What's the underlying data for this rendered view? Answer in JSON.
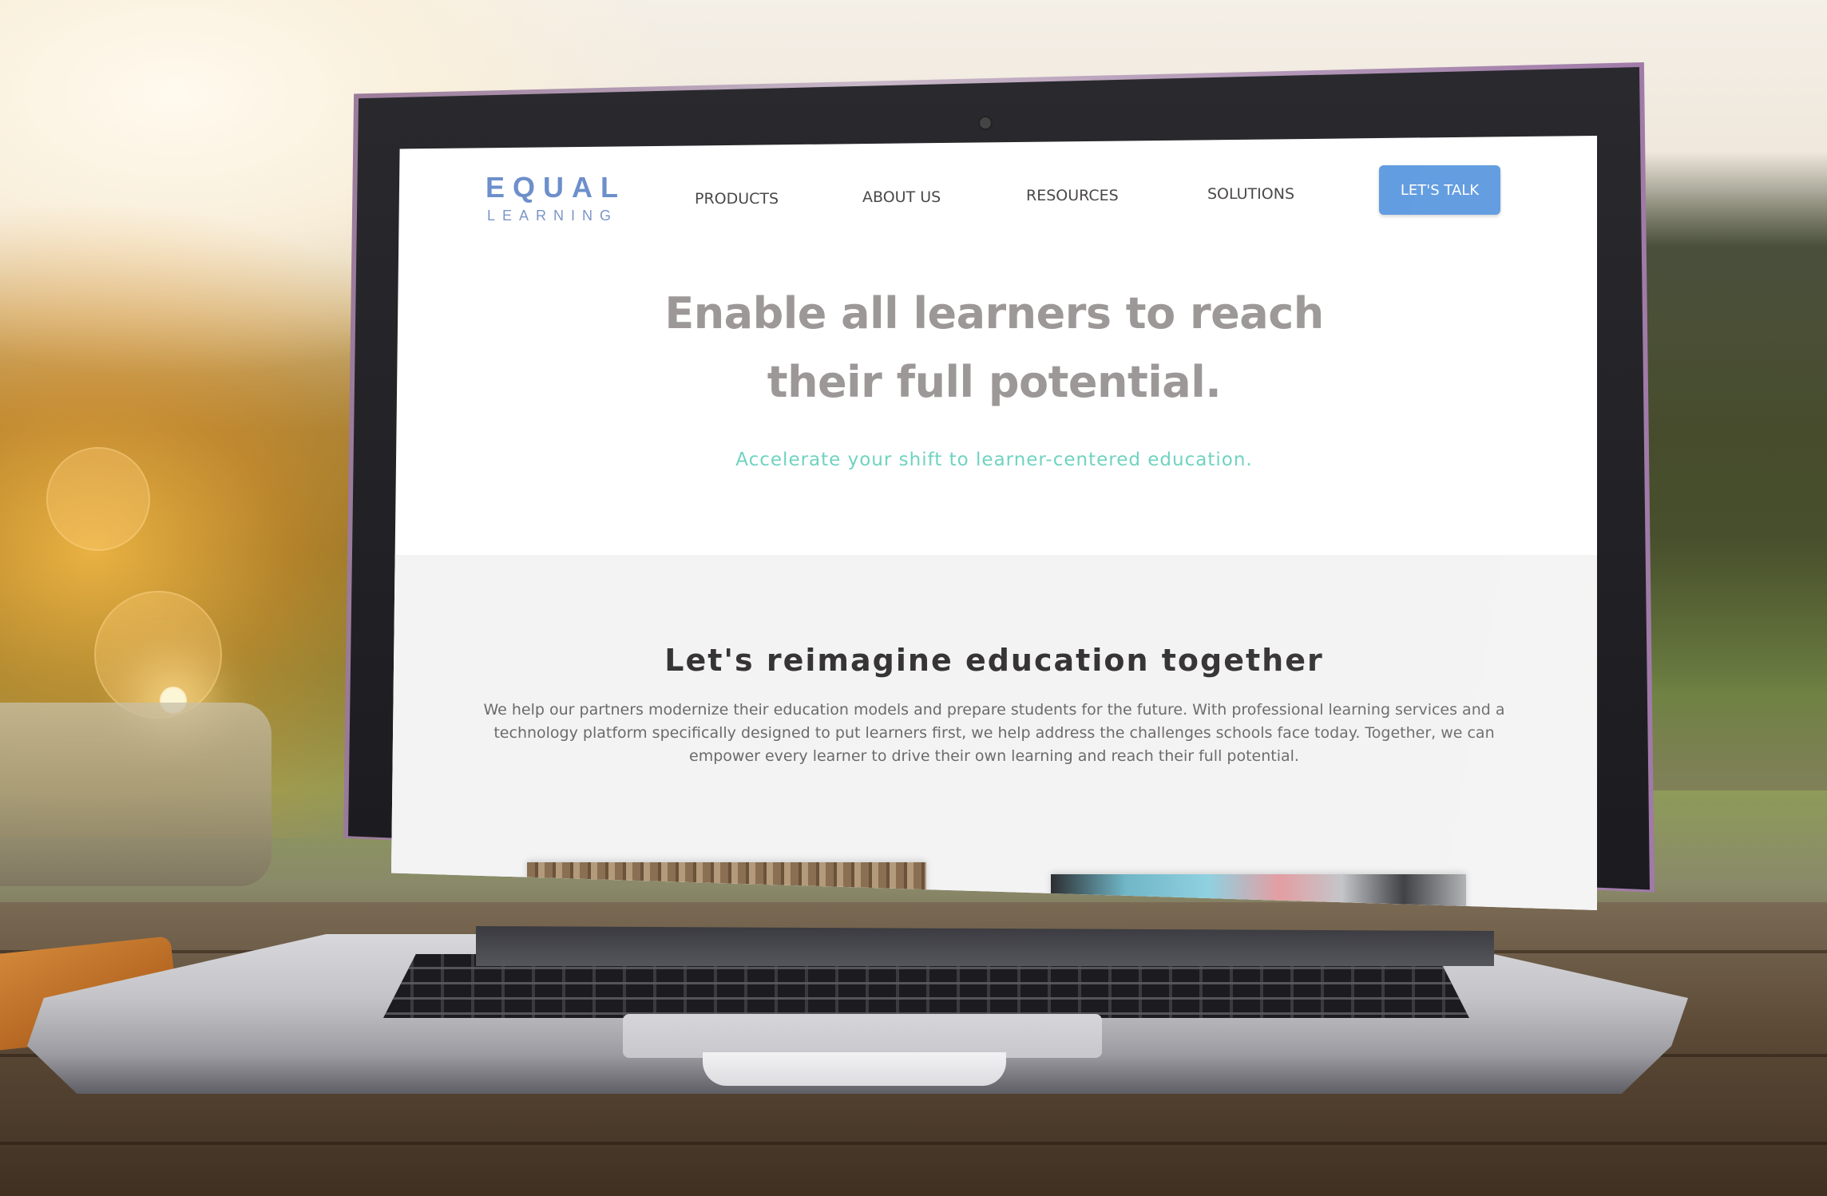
{
  "site": {
    "logo": {
      "main": "EQUAL",
      "sub": "LEARNING"
    },
    "nav": {
      "items": [
        {
          "label": "PRODUCTS"
        },
        {
          "label": "ABOUT US"
        },
        {
          "label": "RESOURCES"
        },
        {
          "label": "SOLUTIONS"
        }
      ],
      "cta_label": "LET'S TALK"
    },
    "hero": {
      "title_line1": "Enable all learners to reach",
      "title_line2": "their full potential.",
      "subtitle": "Accelerate your shift to learner-centered education."
    },
    "intro": {
      "heading": "Let's reimagine education together",
      "body": "We help our partners modernize their education models and prepare students for the future. With professional learning services and a technology platform specifically designed to put learners first, we help address the challenges schools face today. Together, we can empower every learner to drive their own learning and reach their full potential."
    }
  },
  "colors": {
    "logo": "#6d8fcb",
    "cta_background": "#5f9be0",
    "hero_title": "#9d9898",
    "hero_subtitle": "#6fd3c1",
    "section_background": "#f3f3f4"
  },
  "scene": {
    "device": "laptop-icon"
  }
}
